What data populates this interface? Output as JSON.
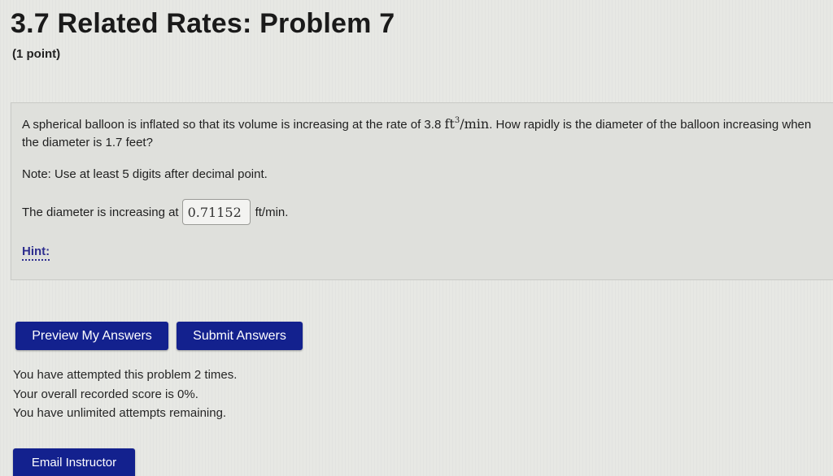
{
  "header": {
    "title": "3.7 Related Rates: Problem 7",
    "points": "(1 point)"
  },
  "problem": {
    "text_before_rate": "A spherical balloon is inflated so that its volume is increasing at the rate of 3.8 ",
    "rate_unit_base": "ft",
    "rate_unit_exponent": "3",
    "rate_unit_per": "/min",
    "text_after_rate": ". How rapidly is the diameter of the balloon increasing when the diameter is 1.7 feet?",
    "note": "Note: Use at least 5 digits after decimal point.",
    "answer_prefix": "The diameter is increasing at",
    "answer_value": "0.71152",
    "answer_unit": "ft/min.",
    "hint_label": "Hint:"
  },
  "buttons": {
    "preview": "Preview My Answers",
    "submit": "Submit Answers",
    "email": "Email Instructor"
  },
  "status": {
    "attempts": "You have attempted this problem 2 times.",
    "score": "Your overall recorded score is 0%.",
    "remaining": "You have unlimited attempts remaining."
  },
  "colors": {
    "button_bg": "#13218e",
    "hint_link": "#2f2f8f",
    "page_bg": "#e7e8e4"
  }
}
